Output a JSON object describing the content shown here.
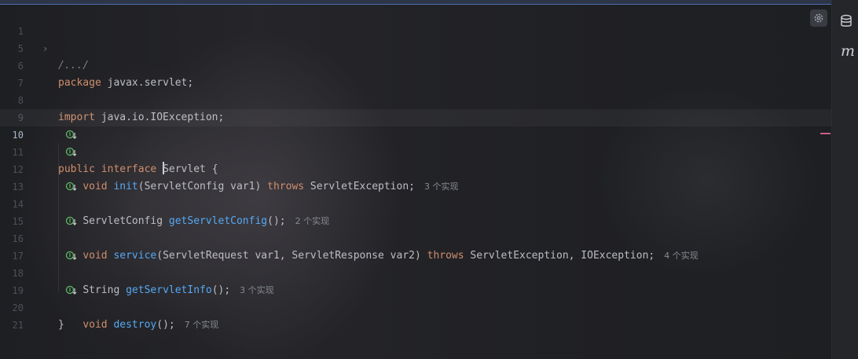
{
  "editor": {
    "lines": [
      {
        "num": "1",
        "folded": true,
        "text": "/.../"
      },
      {
        "num": "5",
        "text": ""
      },
      {
        "num": "6",
        "kw": "package",
        "rest": " javax.servlet;"
      },
      {
        "num": "7",
        "text": ""
      },
      {
        "num": "8",
        "kw": "import",
        "rest": " java.io.IOException;"
      },
      {
        "num": "9",
        "text": ""
      },
      {
        "num": "10",
        "current": true,
        "kw1": "public",
        "kw2": "interface",
        "name": "Servlet",
        "brace": " {"
      },
      {
        "num": "11",
        "kw": "void",
        "fn": "init",
        "params": "(ServletConfig var1) ",
        "throws": "throws",
        "ex": " ServletException;",
        "hint": "3 个实现"
      },
      {
        "num": "12",
        "text": ""
      },
      {
        "num": "13",
        "type": "ServletConfig",
        "fn": "getServletConfig",
        "tail": "();",
        "hint": "2 个实现"
      },
      {
        "num": "14",
        "text": ""
      },
      {
        "num": "15",
        "kw": "void",
        "fn": "service",
        "params": "(ServletRequest var1, ServletResponse var2) ",
        "throws": "throws",
        "ex": " ServletException, IOException;",
        "hint": "4 个实现"
      },
      {
        "num": "16",
        "text": ""
      },
      {
        "num": "17",
        "type": "String",
        "fn": "getServletInfo",
        "tail": "();",
        "hint": "3 个实现"
      },
      {
        "num": "18",
        "text": ""
      },
      {
        "num": "19",
        "kw": "void",
        "fn": "destroy",
        "tail": "();",
        "hint": "7 个实现"
      },
      {
        "num": "20",
        "text": "}"
      },
      {
        "num": "21",
        "text": ""
      }
    ]
  },
  "colors": {
    "keyword": "#cf8e6d",
    "method": "#56a8f5",
    "text": "#bcbec4",
    "hint": "#868a91",
    "implemented_icon": "#5fb865"
  },
  "icons": {
    "gutter": "implemented-icon",
    "settings": "gear-icon",
    "database": "database-icon",
    "maven": "maven-icon"
  },
  "sidebar": {
    "maven_label": "m"
  }
}
